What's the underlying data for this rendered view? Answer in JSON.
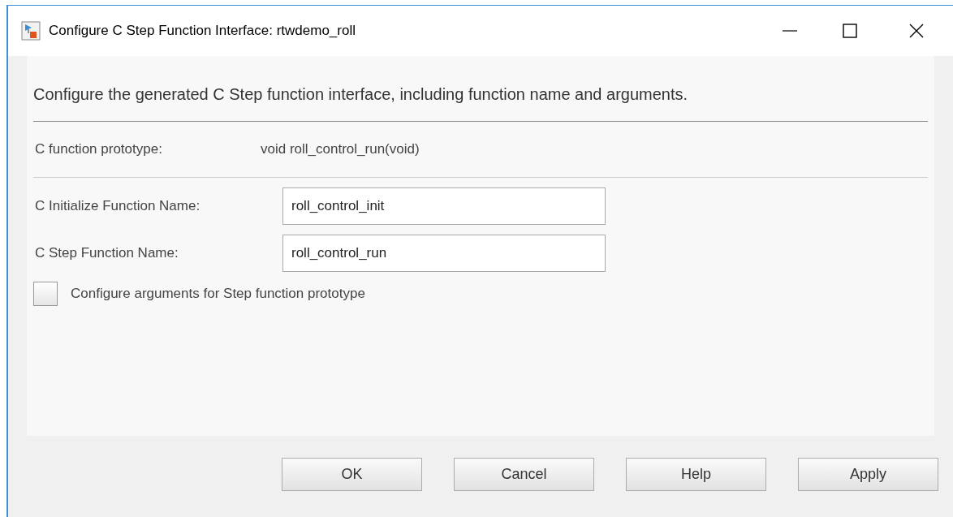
{
  "window": {
    "title": "Configure C Step Function Interface: rtwdemo_roll"
  },
  "description": "Configure the generated C Step function interface, including function name and arguments.",
  "prototype": {
    "label": "C function prototype:",
    "value": "void roll_control_run(void)"
  },
  "fields": [
    {
      "label": "C Initialize Function Name:",
      "value": "roll_control_init"
    },
    {
      "label": "C Step Function Name:",
      "value": "roll_control_run"
    }
  ],
  "checkbox": {
    "label": "Configure arguments for Step function prototype",
    "checked": false
  },
  "buttons": [
    "OK",
    "Cancel",
    "Help",
    "Apply"
  ]
}
